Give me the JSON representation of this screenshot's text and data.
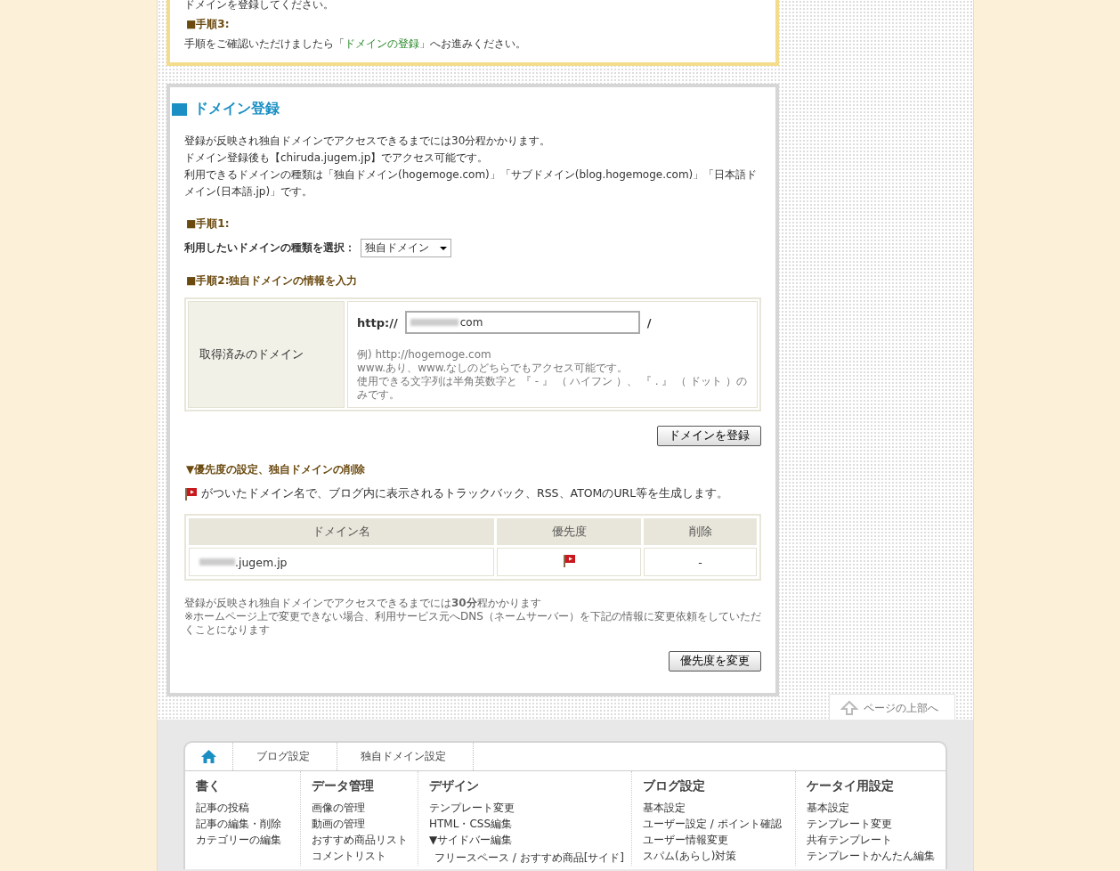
{
  "intro_panel": {
    "lines": [
      {
        "kind": "text",
        "text": "ドメインを登録してください。"
      },
      {
        "kind": "heading",
        "text": "■手順3:"
      },
      {
        "kind": "link_sentence",
        "before": "手順をご確認いただけましたら「",
        "link": "ドメインの登録",
        "after": "」へお進みください。"
      }
    ]
  },
  "domain_panel": {
    "title": "ドメイン登録",
    "description": [
      "登録が反映され独自ドメインでアクセスできるまでには30分程かかります。",
      "ドメイン登録後も【chiruda.jugem.jp】でアクセス可能です。",
      "利用できるドメインの種類は「独自ドメイン(hogemoge.com)」「サブドメイン(blog.hogemoge.com)」「日本語ドメイン(日本語.jp)」です。"
    ],
    "step1": {
      "heading": "■手順1:",
      "label": "利用したいドメインの種類を選択：",
      "select_value": "独自ドメイン"
    },
    "step2": {
      "heading": "■手順2:独自ドメインの情報を入力",
      "row_label": "取得済みのドメイン",
      "prefix": "http://",
      "value": "com",
      "suffix": "/",
      "hints": [
        "例) http://hogemoge.com",
        "www.あり、www.なしのどちらでもアクセス可能です。",
        "使用できる文字列は半角英数字と 『 - 』 （ ハイフン ）、 『 . 』 （ ドット ）のみです。"
      ]
    },
    "register_button": "ドメインを登録",
    "priority_section": {
      "heading": "▼優先度の設定、独自ドメインの削除",
      "note": "がついたドメイン名で、ブログ内に表示されるトラックバック、RSS、ATOMのURL等を生成します。",
      "columns": [
        "ドメイン名",
        "優先度",
        "削除"
      ],
      "rows": [
        {
          "domain": ".jugem.jp",
          "primary": true,
          "delete": "-"
        }
      ]
    },
    "notes": [
      "登録が反映され独自ドメインでアクセスできるまでには**30分**程かかります",
      "※ホームページ上で変更できない場合、利用サービス元へDNS（ネームサーバー）を下記の情報に変更依頼をしていただくことになります"
    ],
    "change_button": "優先度を変更"
  },
  "page_top_link": "ページの上部へ",
  "footer": {
    "breadcrumbs": [
      "ブログ設定",
      "独自ドメイン設定"
    ],
    "columns": [
      {
        "title": "書く",
        "items": [
          {
            "kind": "link",
            "label": "記事の投稿"
          },
          {
            "kind": "link",
            "label": "記事の編集・削除"
          },
          {
            "kind": "link",
            "label": "カテゴリーの編集"
          }
        ]
      },
      {
        "title": "データ管理",
        "items": [
          {
            "kind": "link",
            "label": "画像の管理"
          },
          {
            "kind": "link",
            "label": "動画の管理"
          },
          {
            "kind": "link",
            "label": "おすすめ商品リスト"
          },
          {
            "kind": "link",
            "label": "コメントリスト"
          }
        ]
      },
      {
        "title": "デザイン",
        "items": [
          {
            "kind": "link",
            "label": "テンプレート変更"
          },
          {
            "kind": "link",
            "label": "HTML・CSS編集"
          },
          {
            "kind": "group",
            "label": "▼サイドバー編集"
          },
          {
            "kind": "sub",
            "label": "フリースペース / おすすめ商品[サイド]"
          }
        ]
      },
      {
        "title": "ブログ設定",
        "items": [
          {
            "kind": "link",
            "label": "基本設定"
          },
          {
            "kind": "link",
            "label": "ユーザー設定 / ポイント確認"
          },
          {
            "kind": "link",
            "label": "ユーザー情報変更"
          },
          {
            "kind": "link",
            "label": "スパム(あらし)対策"
          }
        ]
      },
      {
        "title": "ケータイ用設定",
        "items": [
          {
            "kind": "link",
            "label": "基本設定"
          },
          {
            "kind": "link",
            "label": "テンプレート変更"
          },
          {
            "kind": "link",
            "label": "共有テンプレート"
          },
          {
            "kind": "link",
            "label": "テンプレートかんたん編集"
          }
        ]
      }
    ]
  }
}
